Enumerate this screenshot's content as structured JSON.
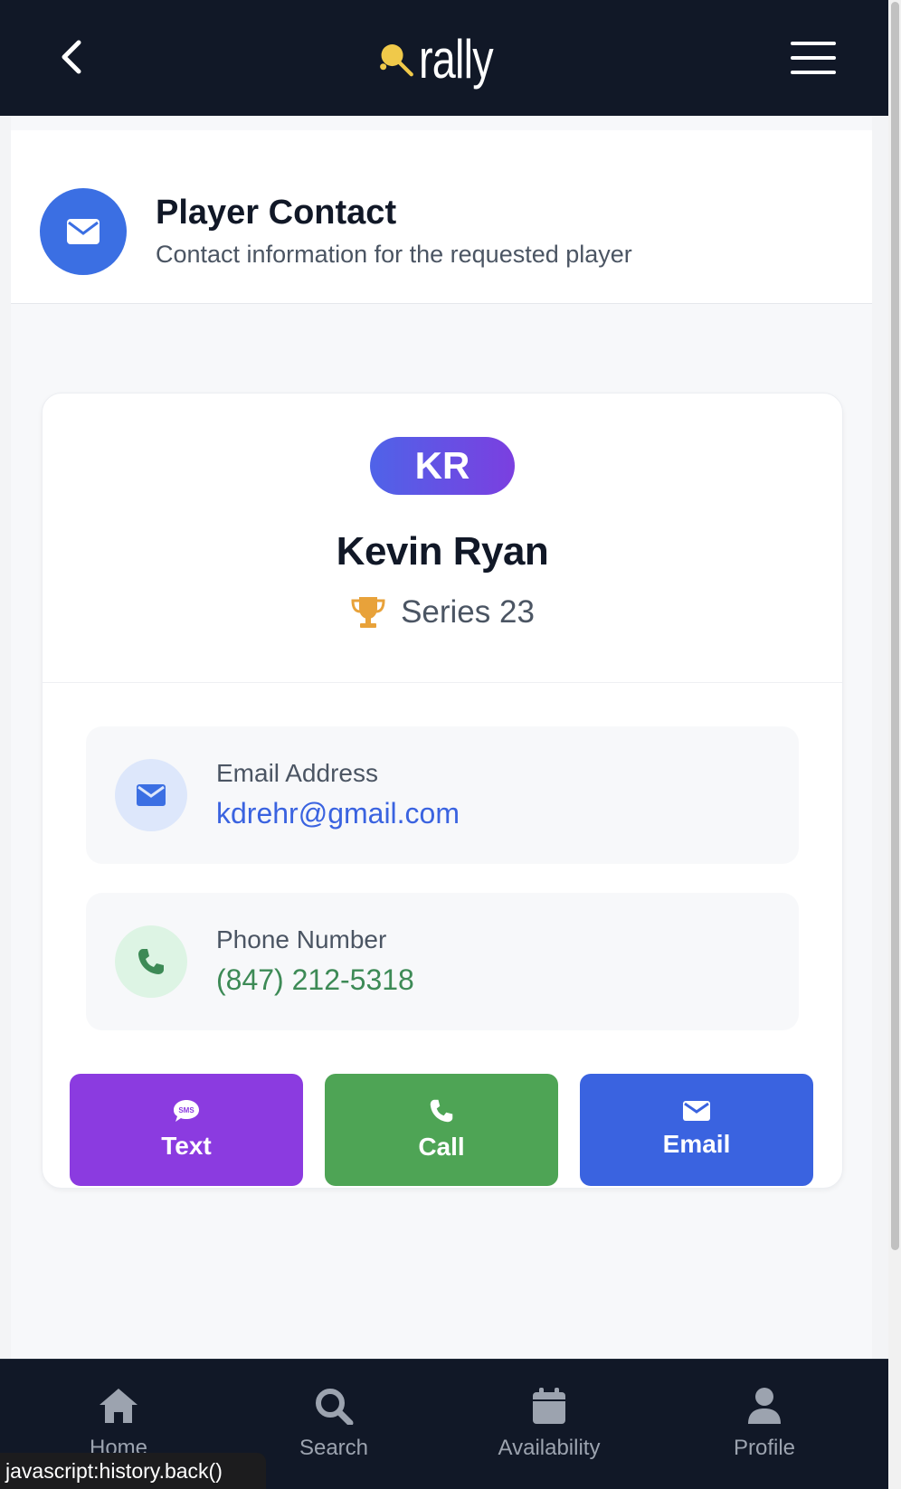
{
  "app": {
    "logo_text": "rally"
  },
  "header": {
    "title": "Player Contact",
    "subtitle": "Contact information for the requested player"
  },
  "player": {
    "initials": "KR",
    "name": "Kevin Ryan",
    "series": "Series 23"
  },
  "contact": {
    "email_label": "Email Address",
    "email_value": "kdrehr@gmail.com",
    "phone_label": "Phone Number",
    "phone_value": "(847) 212-5318"
  },
  "actions": {
    "text_label": "Text",
    "call_label": "Call",
    "email_label": "Email"
  },
  "nav": {
    "home": "Home",
    "search": "Search",
    "availability": "Availability",
    "profile": "Profile"
  },
  "status_bar": {
    "url": "javascript:history.back()"
  },
  "colors": {
    "topbar": "#111827",
    "accent_blue": "#3b6fe3",
    "text_purple": "#8b3be0",
    "call_green": "#4ea455",
    "email_blue": "#3a63e0",
    "phone_green": "#3d8a56",
    "trophy": "#e8a23a"
  },
  "icons": {
    "back": "chevron-left-icon",
    "menu": "hamburger-icon",
    "header": "envelope-icon",
    "series": "trophy-icon",
    "email": "envelope-icon",
    "phone": "phone-icon",
    "text_btn": "sms-bubble-icon",
    "call_btn": "phone-icon",
    "email_btn": "envelope-icon",
    "nav_home": "home-icon",
    "nav_search": "search-icon",
    "nav_availability": "calendar-icon",
    "nav_profile": "user-icon"
  }
}
